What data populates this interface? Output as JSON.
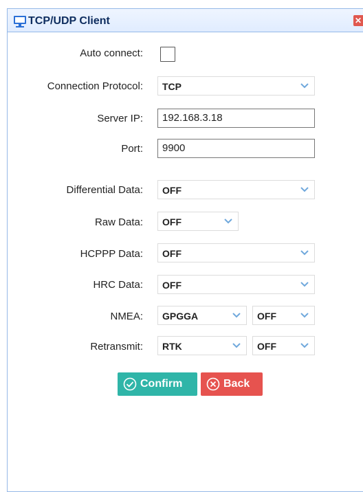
{
  "dialog": {
    "title": "TCP/UDP Client",
    "icon": "monitor-icon",
    "close_icon": "close-icon"
  },
  "form": {
    "auto_connect": {
      "label": "Auto connect:",
      "checked": false
    },
    "connection_protocol": {
      "label": "Connection Protocol:",
      "value": "TCP"
    },
    "server_ip": {
      "label": "Server IP:",
      "value": "192.168.3.18"
    },
    "port": {
      "label": "Port:",
      "value": "9900"
    },
    "differential_data": {
      "label": "Differential Data:",
      "value": "OFF"
    },
    "raw_data": {
      "label": "Raw Data:",
      "value": "OFF"
    },
    "hcppp_data": {
      "label": "HCPPP Data:",
      "value": "OFF"
    },
    "hrc_data": {
      "label": "HRC Data:",
      "value": "OFF"
    },
    "nmea": {
      "label": "NMEA:",
      "type_value": "GPGGA",
      "rate_value": "OFF"
    },
    "retransmit": {
      "label": "Retransmit:",
      "type_value": "RTK",
      "rate_value": "OFF"
    }
  },
  "buttons": {
    "confirm": {
      "label": "Confirm",
      "color": "#2fb5a8",
      "icon": "check-circle-icon"
    },
    "back": {
      "label": "Back",
      "color": "#e6534f",
      "icon": "x-circle-icon"
    }
  }
}
